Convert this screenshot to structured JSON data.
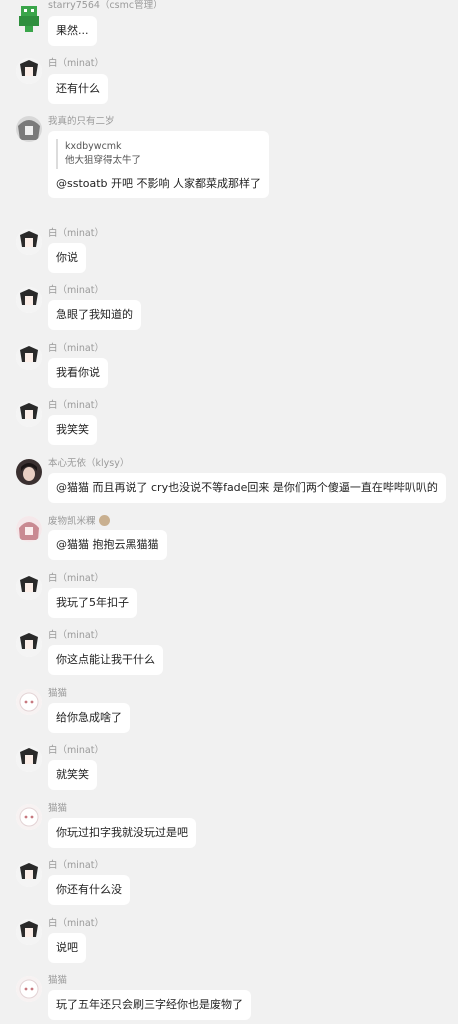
{
  "messages": [
    {
      "avatar": "green-robot-avatar",
      "name": "starry7564（csmc管理）",
      "text": "果然..."
    },
    {
      "avatar": "anime-avatar",
      "name": "白（minat）",
      "text": "还有什么"
    },
    {
      "avatar": "gray-anime-avatar",
      "name": "我真的只有二岁",
      "quote": {
        "name": "kxdbywcmk",
        "text": "他大狙穿得太牛了"
      },
      "text": "@sstoatb 开吧 不影响 人家都菜成那样了"
    },
    {
      "avatar": "anime-avatar",
      "name": "白（minat）",
      "text": "你说"
    },
    {
      "avatar": "anime-avatar",
      "name": "白（minat）",
      "text": "急眼了我知道的"
    },
    {
      "avatar": "anime-avatar",
      "name": "白（minat）",
      "text": "我看你说"
    },
    {
      "avatar": "anime-avatar",
      "name": "白（minat）",
      "text": "我笑笑"
    },
    {
      "avatar": "dark-hair-avatar",
      "name": "本心无依（klysy）",
      "text": "@猫猫 而且再说了 cry也没说不等fade回来 是你们两个傻逼一直在哔哔叭叭的"
    },
    {
      "avatar": "pink-anime-avatar",
      "name": "废物凯米粿",
      "text": "@猫猫 抱抱云黑猫猫"
    },
    {
      "avatar": "anime-avatar",
      "name": "白（minat）",
      "text": "我玩了5年扣子"
    },
    {
      "avatar": "anime-avatar",
      "name": "白（minat）",
      "text": "你这点能让我干什么"
    },
    {
      "avatar": "white-cat-avatar",
      "name": "猫猫",
      "text": "给你急成啥了"
    },
    {
      "avatar": "anime-avatar",
      "name": "白（minat）",
      "text": "就笑笑"
    },
    {
      "avatar": "white-cat-avatar",
      "name": "猫猫",
      "text": "你玩过扣字我就没玩过是吧"
    },
    {
      "avatar": "anime-avatar",
      "name": "白（minat）",
      "text": "你还有什么没"
    },
    {
      "avatar": "anime-avatar",
      "name": "白（minat）",
      "text": "说吧"
    },
    {
      "avatar": "white-cat-avatar",
      "name": "猫猫",
      "text": "玩了五年还只会刷三字经你也是废物了"
    }
  ]
}
